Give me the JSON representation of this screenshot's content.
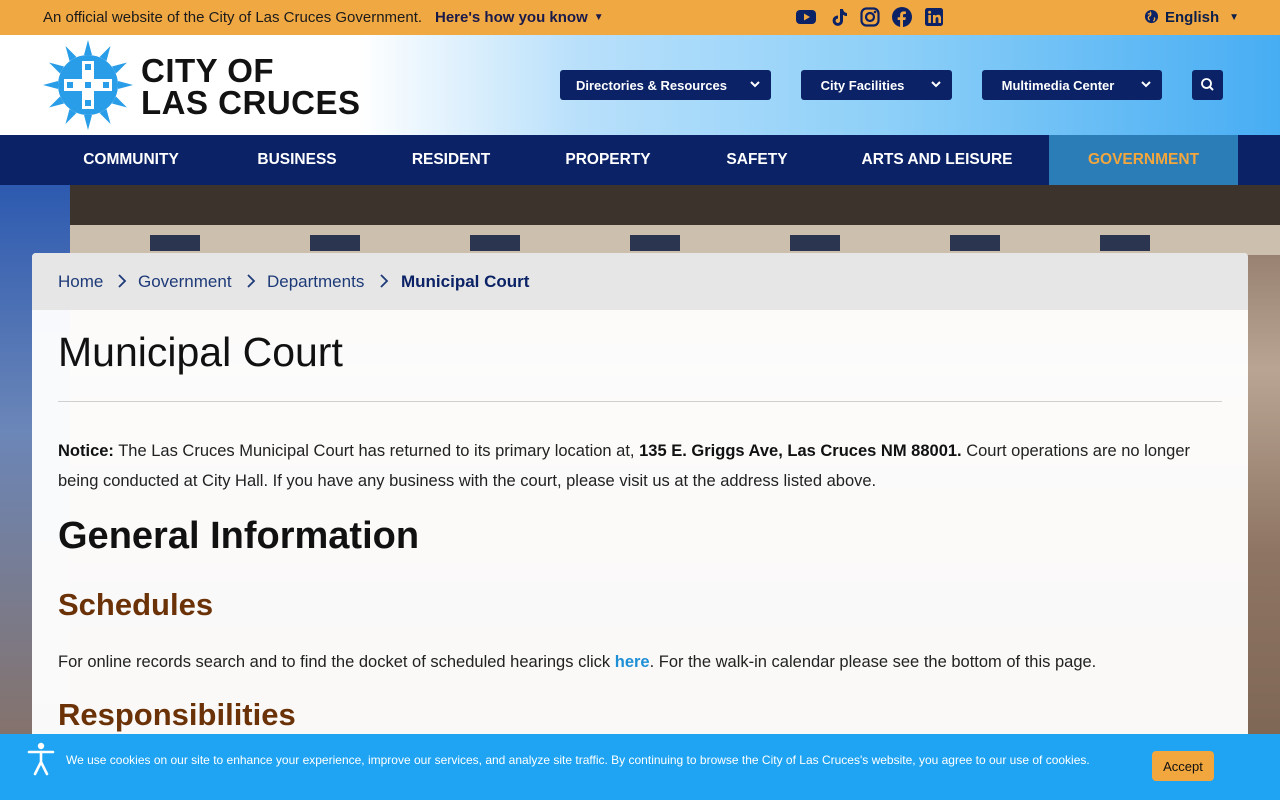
{
  "topbar": {
    "official_text": "An official website of the City of Las Cruces Government.",
    "howto_label": "Here's how you know",
    "language_label": "English",
    "social_icons": [
      "youtube-icon",
      "tiktok-icon",
      "instagram-icon",
      "facebook-icon",
      "linkedin-icon"
    ]
  },
  "header": {
    "logo_line1": "CITY OF",
    "logo_line2": "LAS CRUCES",
    "dropdowns": [
      {
        "label": "Directories & Resources"
      },
      {
        "label": "City Facilities"
      },
      {
        "label": "Multimedia Center"
      }
    ]
  },
  "nav": {
    "items": [
      {
        "label": "COMMUNITY"
      },
      {
        "label": "BUSINESS"
      },
      {
        "label": "RESIDENT"
      },
      {
        "label": "PROPERTY"
      },
      {
        "label": "SAFETY"
      },
      {
        "label": "ARTS AND LEISURE"
      },
      {
        "label": "GOVERNMENT"
      }
    ],
    "active": "GOVERNMENT"
  },
  "breadcrumb": {
    "items": [
      "Home",
      "Government",
      "Departments"
    ],
    "current": "Municipal Court"
  },
  "main": {
    "title": "Municipal Court",
    "notice_label": "Notice:",
    "notice_text1": " The Las Cruces Municipal Court has returned to its primary location at, ",
    "notice_address": "135 E. Griggs Ave,  Las Cruces NM 88001.",
    "notice_text2": " Court operations are no longer being conducted at City Hall. If you have any business with the court, please visit us at the address listed above.",
    "general_heading": "General Information",
    "schedules_heading": "Schedules",
    "schedules_text1": "For online records search and to find the docket of scheduled hearings click ",
    "schedules_link": "here",
    "schedules_text2": ". For the walk-in calendar please see the bottom of this page.",
    "responsibilities_heading": "Responsibilities"
  },
  "cookie": {
    "text": "We use cookies on our site to enhance your experience, improve our services, and analyze site traffic. By continuing to browse the City of Las Cruces's website, you agree to our use of cookies.",
    "accept_label": "Accept"
  },
  "colors": {
    "topbar": "#f0a843",
    "navy": "#0b2266",
    "active_nav_bg": "#2b7db8",
    "active_nav_text": "#f1a63e",
    "heading_brown": "#6b3208",
    "link": "#1f8fd6",
    "cookie_bar": "#1ea4f2"
  }
}
